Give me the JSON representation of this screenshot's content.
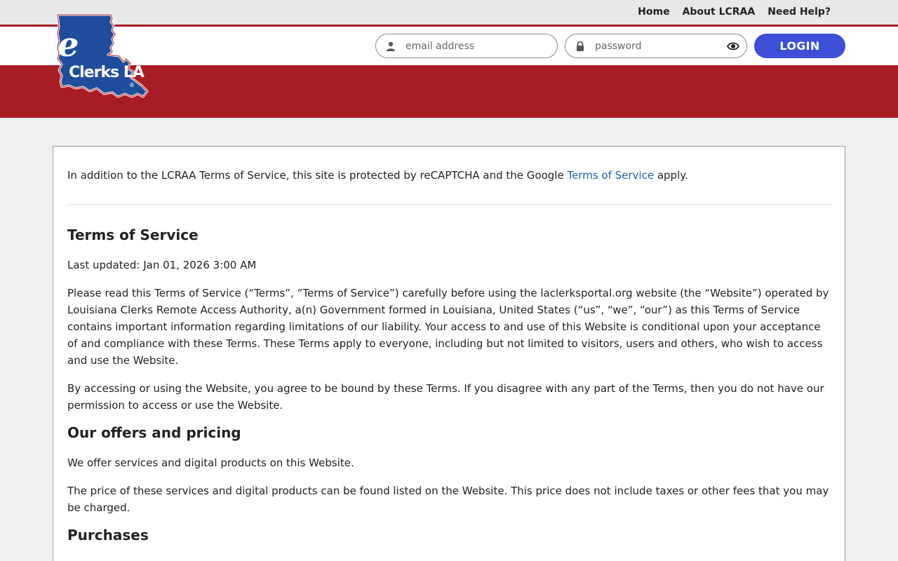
{
  "header": {
    "nav": [
      {
        "label": "Home"
      },
      {
        "label": "About LCRAA"
      },
      {
        "label": "Need Help?"
      }
    ],
    "logo_text": "eClerks LA",
    "email_placeholder": "email address",
    "password_placeholder": "password",
    "login_label": "LOGIN"
  },
  "colors": {
    "brand_red": "#a81c26",
    "login_blue": "#3c4fd6",
    "logo_blue": "#1f4d9b",
    "link_blue": "#1f5ea8"
  },
  "notice": {
    "before": "In addition to the LCRAA Terms of Service, this site is protected by reCAPTCHA and the Google ",
    "link": "Terms of Service",
    "after": " apply."
  },
  "content": {
    "title": "Terms of Service",
    "updated": "Last updated: Jan 01, 2026 3:00 AM",
    "p1": "Please read this Terms of Service (“Terms”, “Terms of Service”) carefully before using the laclerksportal.org website (the “Website”) operated by Louisiana Clerks Remote Access Authority, a(n) Government formed in Louisiana, United States (“us”, “we”, “our”) as this Terms of Service contains important information regarding limitations of our liability. Your access to and use of this Website is conditional upon your acceptance of and compliance with these Terms. These Terms apply to everyone, including but not limited to visitors, users and others, who wish to access and use the Website.",
    "p2": "By accessing or using the Website, you agree to be bound by these Terms. If you disagree with any part of the Terms, then you do not have our permission to access or use the Website.",
    "h_offers": "Our offers and pricing",
    "p3": "We offer services and digital products on this Website.",
    "p4": "The price of these services and digital products can be found listed on the Website. This price does not include taxes or other fees that you may be charged.",
    "h_purchases": "Purchases"
  }
}
